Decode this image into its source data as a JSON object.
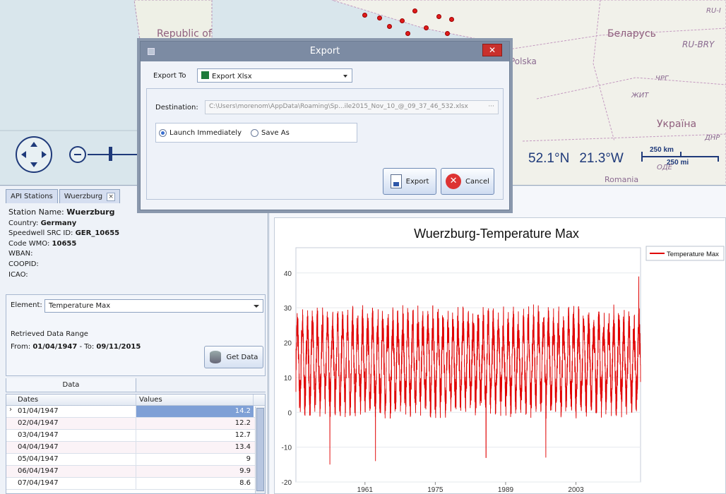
{
  "map": {
    "labels": [
      "Republic of",
      "Беларусь",
      "RU-BRY",
      "Polska",
      "ЧРГ",
      "ЖИТ",
      "Україна",
      "ДНР",
      "Romania",
      "ОДЕ",
      "RU-I"
    ],
    "latitude": "52.1°N",
    "longitude": "21.3°W",
    "scale_km": "250 km",
    "scale_mi": "250 mi"
  },
  "left_tabs": [
    {
      "label": "API Stations"
    },
    {
      "label": "Wuerzburg",
      "close": "×"
    }
  ],
  "station": {
    "name_label": "Station Name:",
    "name": "Wuerzburg",
    "country_label": "Country:",
    "country": "Germany",
    "src_label": "Speedwell SRC ID:",
    "src": "GER_10655",
    "wmo_label": "Code WMO:",
    "wmo": "10655",
    "wban_label": "WBAN:",
    "coopid_label": "COOPID:",
    "icao_label": "ICAO:"
  },
  "element": {
    "label": "Element:",
    "value": "Temperature Max"
  },
  "range": {
    "title": "Retrieved Data Range",
    "from_label": "From:",
    "from": "01/04/1947",
    "to_label": "- To:",
    "to": "09/11/2015"
  },
  "get_data_label": "Get Data",
  "data_tab_label": "Data",
  "grid": {
    "columns": [
      "Dates",
      "Values"
    ],
    "rows": [
      {
        "date": "01/04/1947",
        "value": "14.2",
        "selected": true,
        "marker": "›"
      },
      {
        "date": "02/04/1947",
        "value": "12.2"
      },
      {
        "date": "03/04/1947",
        "value": "12.7"
      },
      {
        "date": "04/04/1947",
        "value": "13.4"
      },
      {
        "date": "05/04/1947",
        "value": "9"
      },
      {
        "date": "06/04/1947",
        "value": "9.9"
      },
      {
        "date": "07/04/1947",
        "value": "8.6"
      }
    ]
  },
  "right_tab_label": "Data",
  "dialog": {
    "title": "Export",
    "close": "✕",
    "export_to_label": "Export To",
    "export_to_value": "Export Xlsx",
    "destination_label": "Destination:",
    "destination_value": "C:\\Users\\morenom\\AppData\\Roaming\\Sp...ile2015_Nov_10_@_09_37_46_532.xlsx",
    "destination_button": "···",
    "radio_launch": "Launch Immediately",
    "radio_save": "Save As",
    "export_button": "Export",
    "cancel_button": "Cancel",
    "cancel_icon": "✕"
  },
  "chart_data": {
    "type": "line",
    "title": "Wuerzburg-Temperature Max",
    "series": [
      {
        "name": "Temperature Max",
        "color": "#e00000"
      }
    ],
    "xlim": [
      1947.25,
      2015.86
    ],
    "x_ticks": [
      1961,
      1975,
      1989,
      2003
    ],
    "ylim": [
      -20,
      44
    ],
    "y_ticks": [
      -20,
      -10,
      0,
      10,
      20,
      30,
      40
    ],
    "seasonal_model": {
      "annual_mean_c": 14.5,
      "seasonal_amplitude_c": 10.5,
      "daily_noise_c": 6,
      "period_years": 1
    },
    "extremes": [
      {
        "year": 1954.0,
        "value": -15
      },
      {
        "year": 1963.1,
        "value": -14
      },
      {
        "year": 1985.1,
        "value": -13
      },
      {
        "year": 1997.0,
        "value": -13
      },
      {
        "year": 2015.5,
        "value": 39
      }
    ],
    "grid": true,
    "legend": "right"
  }
}
